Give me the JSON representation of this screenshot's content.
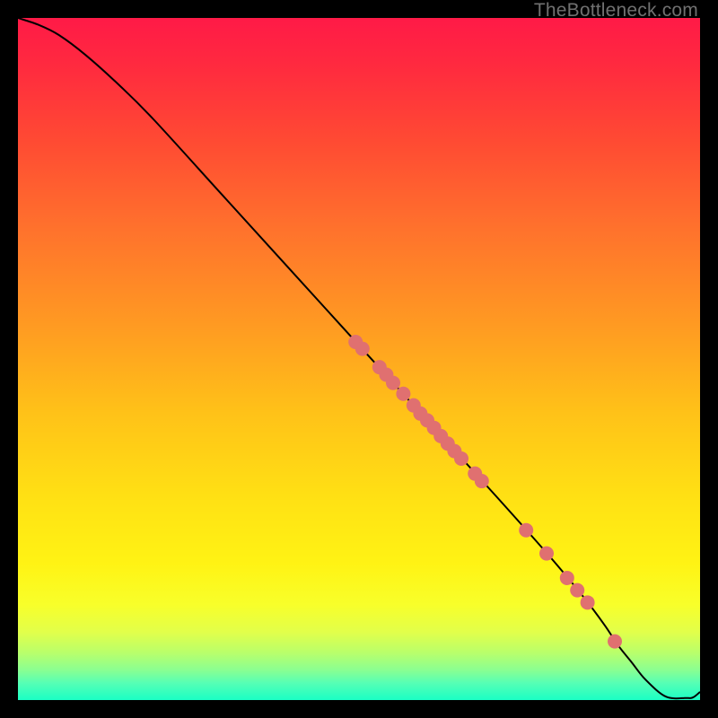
{
  "watermark": "TheBottleneck.com",
  "chart_data": {
    "type": "line",
    "title": "",
    "xlabel": "",
    "ylabel": "",
    "xlim": [
      0,
      100
    ],
    "ylim": [
      0,
      100
    ],
    "background_gradient": {
      "stops": [
        {
          "offset": 0.0,
          "color": "#ff1a47"
        },
        {
          "offset": 0.07,
          "color": "#ff2a3f"
        },
        {
          "offset": 0.18,
          "color": "#ff4a33"
        },
        {
          "offset": 0.3,
          "color": "#ff6f2d"
        },
        {
          "offset": 0.45,
          "color": "#ff9a22"
        },
        {
          "offset": 0.58,
          "color": "#ffc218"
        },
        {
          "offset": 0.7,
          "color": "#ffe014"
        },
        {
          "offset": 0.8,
          "color": "#fff314"
        },
        {
          "offset": 0.86,
          "color": "#f8ff2a"
        },
        {
          "offset": 0.9,
          "color": "#e2ff4a"
        },
        {
          "offset": 0.93,
          "color": "#baff6a"
        },
        {
          "offset": 0.955,
          "color": "#8cff90"
        },
        {
          "offset": 0.975,
          "color": "#56ffb5"
        },
        {
          "offset": 1.0,
          "color": "#1affc4"
        }
      ]
    },
    "curve": {
      "x": [
        0,
        3,
        6,
        10,
        15,
        20,
        30,
        40,
        50,
        60,
        70,
        78,
        83,
        86,
        88,
        90,
        92,
        95,
        98,
        99,
        100
      ],
      "y": [
        100,
        99,
        97.5,
        94.5,
        90,
        85,
        74,
        63,
        52,
        41,
        30,
        21,
        15,
        11,
        8,
        5.5,
        3,
        0.5,
        0.3,
        0.4,
        1.2
      ]
    },
    "markers": {
      "color": "#e07070",
      "size": 8,
      "points": [
        {
          "x": 49.5,
          "y": 52.5
        },
        {
          "x": 50.5,
          "y": 51.5
        },
        {
          "x": 53.0,
          "y": 48.8
        },
        {
          "x": 54.0,
          "y": 47.7
        },
        {
          "x": 55.0,
          "y": 46.5
        },
        {
          "x": 56.5,
          "y": 44.9
        },
        {
          "x": 58.0,
          "y": 43.2
        },
        {
          "x": 59.0,
          "y": 42.0
        },
        {
          "x": 60.0,
          "y": 41.0
        },
        {
          "x": 61.0,
          "y": 39.9
        },
        {
          "x": 62.0,
          "y": 38.7
        },
        {
          "x": 63.0,
          "y": 37.6
        },
        {
          "x": 64.0,
          "y": 36.5
        },
        {
          "x": 65.0,
          "y": 35.4
        },
        {
          "x": 67.0,
          "y": 33.2
        },
        {
          "x": 68.0,
          "y": 32.1
        },
        {
          "x": 74.5,
          "y": 24.9
        },
        {
          "x": 77.5,
          "y": 21.5
        },
        {
          "x": 80.5,
          "y": 17.9
        },
        {
          "x": 82.0,
          "y": 16.1
        },
        {
          "x": 83.5,
          "y": 14.3
        },
        {
          "x": 87.5,
          "y": 8.6
        }
      ]
    }
  }
}
